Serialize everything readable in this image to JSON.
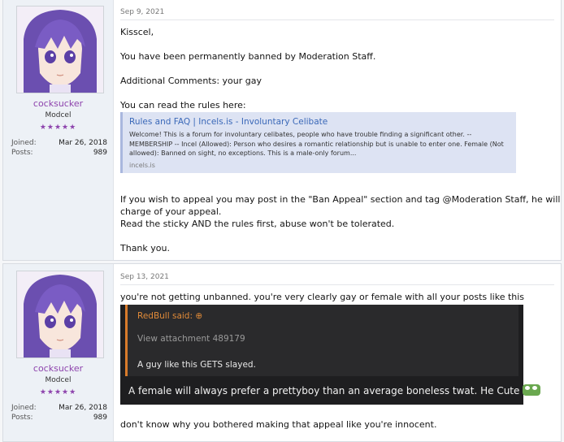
{
  "posts": [
    {
      "user": {
        "name": "cocksucker",
        "title": "Modcel",
        "stars": "★★★★★",
        "joined_label": "Joined:",
        "joined_value": "Mar 26, 2018",
        "posts_label": "Posts:",
        "posts_value": "989"
      },
      "date": "Sep 9, 2021",
      "lines": [
        "Kisscel,",
        "You have been permanently banned by Moderation Staff.",
        "Additional Comments: your gay",
        "You can read the rules here:",
        "If you wish to appeal you may post in the \"Ban Appeal\" section and tag @Moderation Staff, he will be in",
        "charge of your appeal.",
        "Read the sticky AND the rules first, abuse won't be tolerated.",
        "Thank you."
      ],
      "unfurl": {
        "title": "Rules and FAQ | Incels.is - Involuntary Celibate",
        "description": "Welcome! This is a forum for involuntary celibates, people who have trouble finding a significant other. -- MEMBERSHIP -- Incel (Allowed): Person who desires a romantic relationship but is unable to enter one. Female (Not allowed): Banned on sight, no exceptions. This is a male-only forum...",
        "domain": "incels.is"
      }
    },
    {
      "user": {
        "name": "cocksucker",
        "title": "Modcel",
        "stars": "★★★★★",
        "joined_label": "Joined:",
        "joined_value": "Mar 26, 2018",
        "posts_label": "Posts:",
        "posts_value": "989"
      },
      "date": "Sep 13, 2021",
      "lines": [
        "you're not getting unbanned. you're very clearly gay or female with all your posts like this",
        "don't know why you bothered making that appeal like you're innocent."
      ],
      "quote": {
        "author": "RedBull said: ⊕",
        "attachment": "View attachment 489179",
        "said": "A guy like this GETS slayed.",
        "reply": "A female will always prefer a prettyboy than an average boneless twat. He Cute"
      }
    }
  ]
}
